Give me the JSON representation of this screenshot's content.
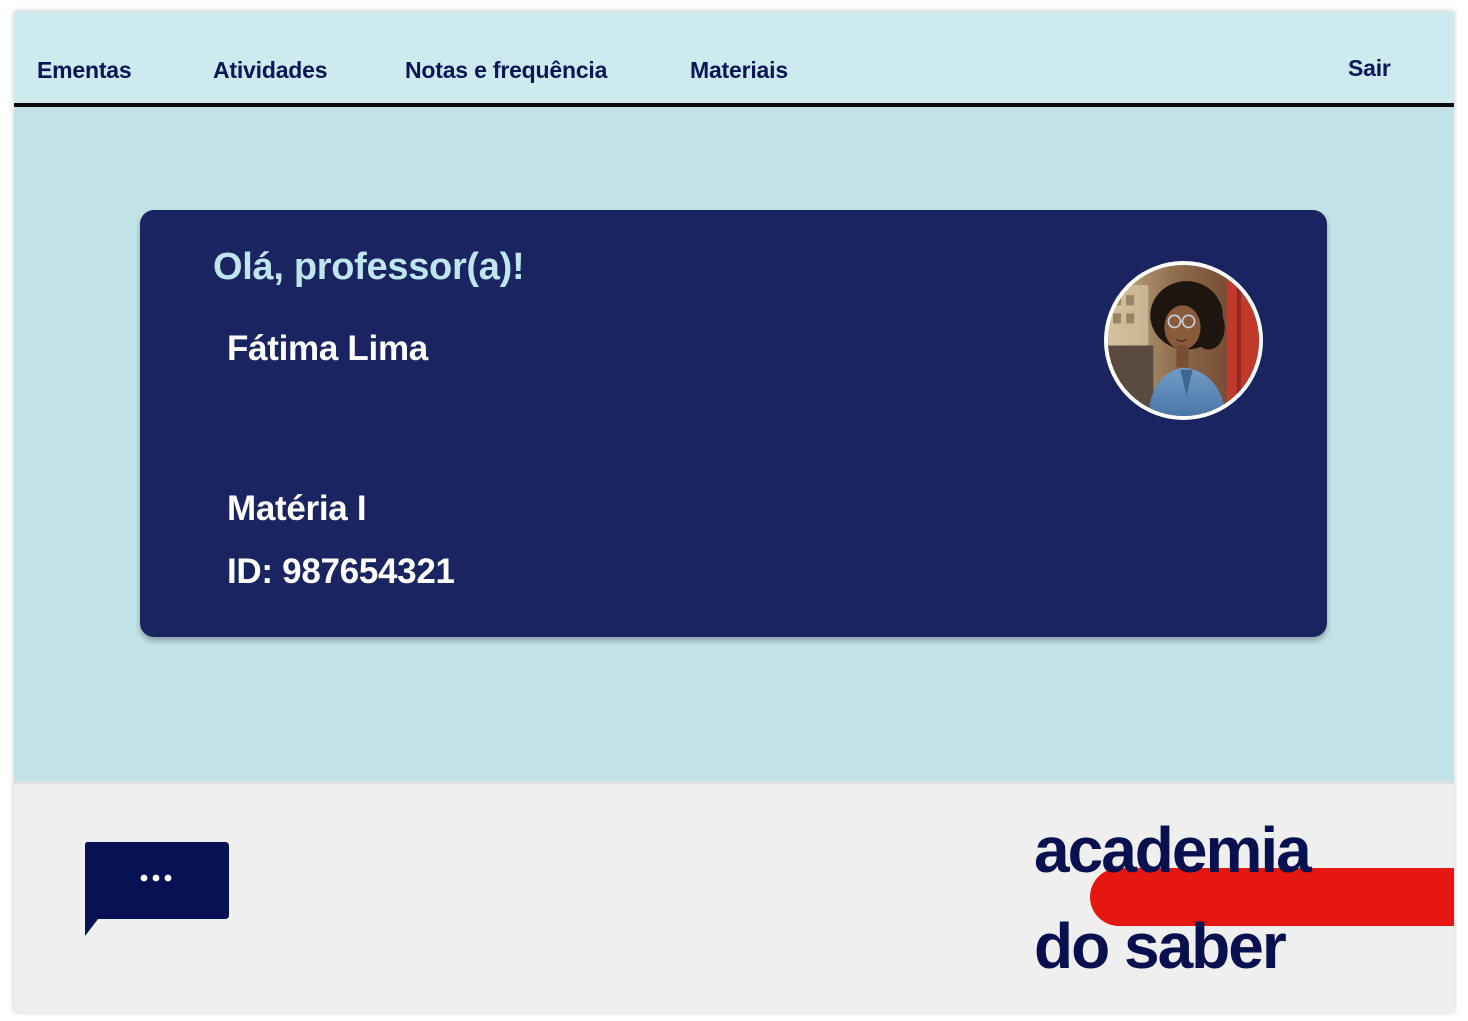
{
  "nav": {
    "links": [
      {
        "label": "Ementas"
      },
      {
        "label": "Atividades"
      },
      {
        "label": "Notas e frequência"
      },
      {
        "label": "Materiais"
      }
    ],
    "logout_label": "Sair"
  },
  "profile": {
    "greeting": "Olá, professor(a)!",
    "name": "Fátima Lima",
    "subject": "Matéria I",
    "id_text": "ID: 987654321"
  },
  "footer": {
    "chat_icon": "chat-bubble-ellipsis-icon",
    "logo_line1": "academia",
    "logo_line2": "do saber"
  },
  "colors": {
    "nav_bg": "#cdeaef",
    "page_bg": "#c1e3e8",
    "card_bg": "#1a2460",
    "greeting_text": "#bfe6ee",
    "brand_navy": "#08104f",
    "brand_red": "#e61610",
    "footer_bg": "#efefef"
  }
}
